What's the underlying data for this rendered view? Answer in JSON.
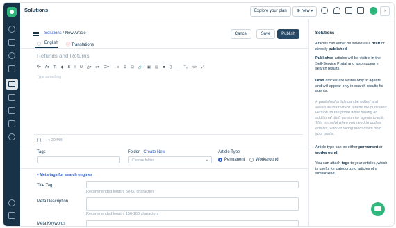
{
  "header": {
    "title": "Solutions",
    "explore_plan": "Explore your plan",
    "new_label": "New",
    "new_caret": "▾",
    "collapse_glyph": "›"
  },
  "sidebar": {
    "icons": [
      "logo-icon",
      "help-icon",
      "inbox-icon",
      "contacts-icon",
      "alert-icon",
      "solutions-icon",
      "tickets-icon",
      "chat-icon",
      "reports-icon",
      "admin-icon",
      "settings-icon",
      "feedback-icon",
      "apps-icon"
    ]
  },
  "editor": {
    "breadcrumb_parent": "Solutions",
    "breadcrumb_sep": "/",
    "breadcrumb_current": "New Article",
    "cancel": "Cancel",
    "save": "Save",
    "publish": "Publish",
    "tab_english": "English",
    "tab_translations": "Translations",
    "title_placeholder": "Refunds and Returns",
    "body_placeholder": "Type something",
    "toolbar": [
      "¶▾",
      "A▾",
      "Tᵢ",
      "◆",
      "B",
      "I",
      "U",
      "A̲▾",
      "≡▾",
      "☰▾",
      "⋮≡",
      "⊞",
      "⊟",
      "🔗",
      "▣",
      "▤",
      "■",
      "{}",
      "—",
      "Tₓ",
      "</>",
      "⤢"
    ],
    "attachment_size": "< 20 MB"
  },
  "fields": {
    "tags_label": "Tags",
    "folder_label": "Folder",
    "folder_dash": " - ",
    "create_new": "Create New",
    "folder_placeholder": "Choose folder",
    "folder_caret": "⌄",
    "article_type_label": "Article Type",
    "type_permanent": "Permanent",
    "type_workaround": "Workaround",
    "meta_toggle": "▾ Meta tags for search engines",
    "title_tag_label": "Title Tag",
    "title_tag_hint": "Recommended length: 50-60 characters",
    "meta_desc_label": "Meta Description",
    "meta_desc_hint": "Recommended length: 150-160 characters",
    "meta_keywords_label": "Meta Keywords"
  },
  "right_panel": {
    "heading": "Solutions",
    "p1_a": "Articles can either be saved as a ",
    "p1_b": "draft",
    "p1_c": " or directly ",
    "p1_d": "published",
    "p1_e": ".",
    "p2_a": "Published",
    "p2_b": " articles will be visible in the Self-Service Portal and also appear in search results.",
    "p3_a": "Draft",
    "p3_b": " articles are visible only to agents, and will appear only in search results for agents.",
    "p4": "A published article can be edited and saved as draft which retains the published version on the portal while having an additional draft version for agents to edit. This is useful when you need to update articles, without taking them down from your portal.",
    "p5_a": "Article type can be either ",
    "p5_b": "permanent",
    "p5_c": " or ",
    "p5_d": "workaround",
    "p5_e": ".",
    "p6_a": "You can attach ",
    "p6_b": "tags",
    "p6_c": " to your articles, which is useful for categorizing articles of a similar kind."
  },
  "colors": {
    "sidebar": "#183247",
    "accent": "#2c5cc5",
    "brand_green": "#2fb67c",
    "primary_button": "#264966"
  }
}
